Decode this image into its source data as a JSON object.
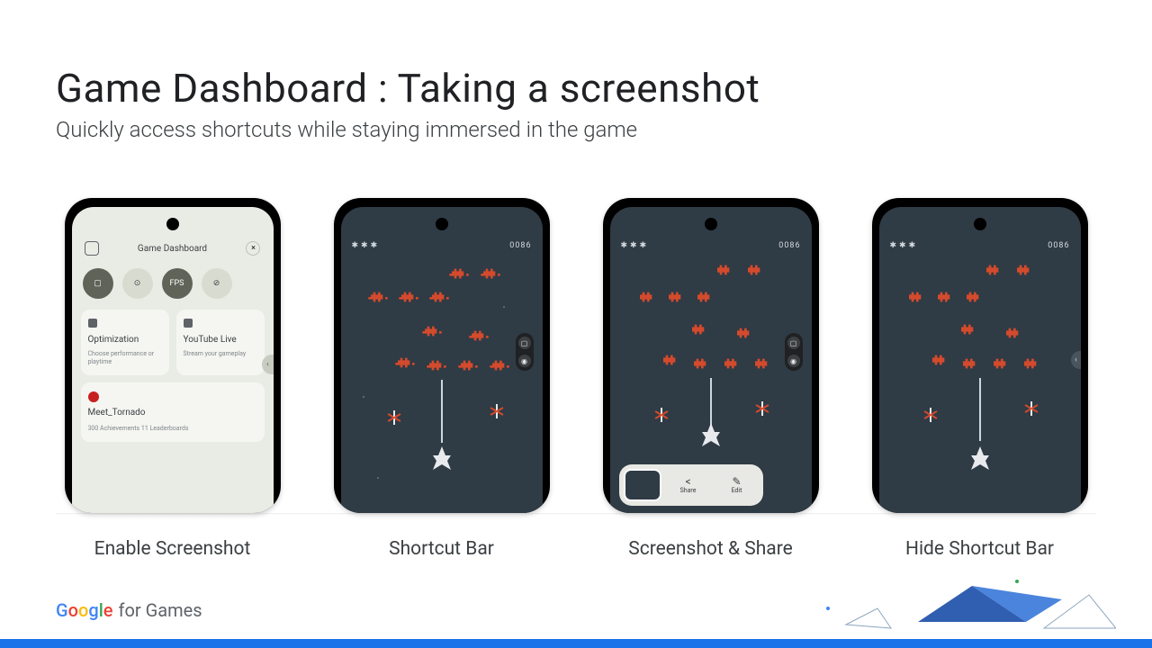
{
  "heading": {
    "title": "Game Dashboard : Taking a screenshot",
    "subtitle": "Quickly access shortcuts while staying immersed in the game"
  },
  "captions": {
    "c1": "Enable Screenshot",
    "c2": "Shortcut Bar",
    "c3": "Screenshot & Share",
    "c4": "Hide Shortcut Bar"
  },
  "dashboard": {
    "title": "Game Dashboard",
    "close": "×",
    "chips": {
      "fps": "FPS"
    },
    "cards": {
      "opt": {
        "title": "Optimization",
        "sub": "Choose performance or playtime"
      },
      "yt": {
        "title": "YouTube Live",
        "sub": "Stream your gameplay"
      }
    },
    "profile": {
      "name": "Meet_Tornado",
      "sub": "300 Achievements  11 Leaderboards"
    }
  },
  "game": {
    "lives_glyph": "✱",
    "score": "0086"
  },
  "share_actions": {
    "share": "Share",
    "edit": "Edit"
  },
  "footer": {
    "g": "G",
    "o1": "o",
    "o2": "o",
    "g2": "g",
    "l": "l",
    "e": "e",
    "for_games": " for Games"
  }
}
